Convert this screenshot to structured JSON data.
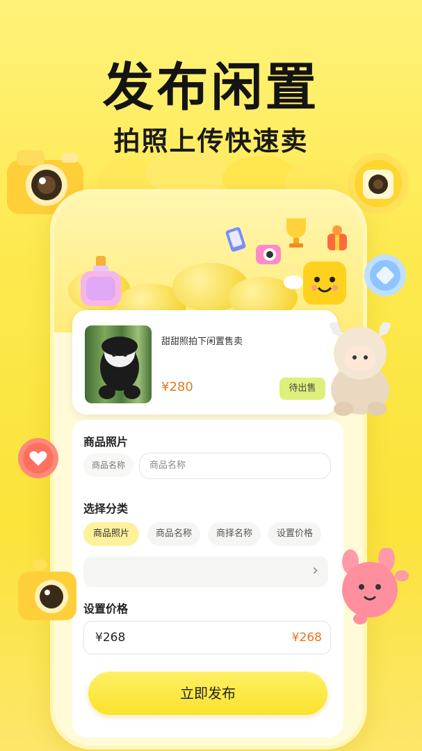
{
  "hero": {
    "title": "发布闲置",
    "subtitle": "拍照上传快速卖"
  },
  "product": {
    "title": "甜甜照拍下闲置售卖",
    "price": "¥280",
    "status_label": "待出售"
  },
  "form": {
    "photo_section": {
      "label": "商品照片",
      "chip_label": "商品名称",
      "input_placeholder": "商品名称"
    },
    "category_section": {
      "label": "选择分类",
      "chips": [
        "商品照片",
        "商品名称",
        "商择名称",
        "设置价格"
      ],
      "active_index": 0,
      "chevron": "›"
    },
    "price_section": {
      "label": "设置价格",
      "value": "¥268",
      "preview": "¥268"
    },
    "publish_button": "立即发布"
  },
  "colors": {
    "accent_yellow": "#fbe22b",
    "price_orange": "#e8761c",
    "status_green": "#dff07a"
  },
  "icons": [
    "camera-icon",
    "perfume-icon",
    "phone-icon",
    "trophy-icon",
    "gift-icon",
    "heart-icon",
    "chevron-right-icon"
  ]
}
